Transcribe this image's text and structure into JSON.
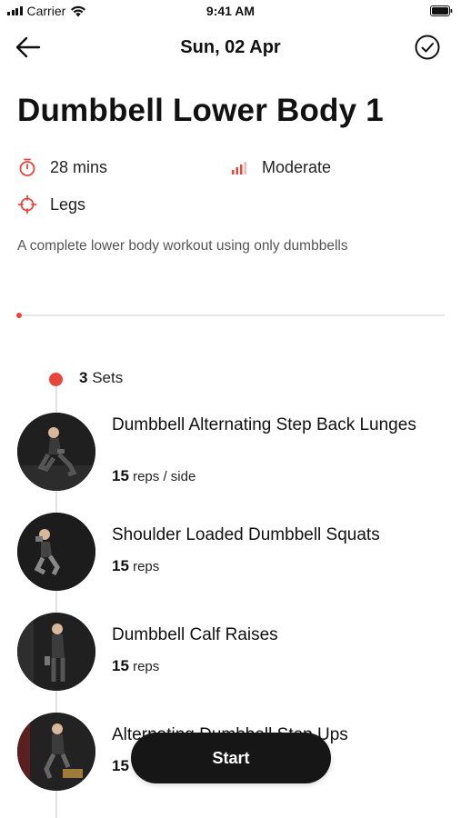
{
  "status_bar": {
    "carrier": "Carrier",
    "time": "9:41 AM"
  },
  "header": {
    "date": "Sun, 02 Apr",
    "back_icon": "arrow-left-icon",
    "done_icon": "check-circle-icon"
  },
  "workout": {
    "title": "Dumbbell Lower Body 1",
    "duration": "28 mins",
    "difficulty": "Moderate",
    "target": "Legs",
    "description": "A complete lower body workout using only dumbbells",
    "progress_fraction": 0.0
  },
  "sets": {
    "count": "3",
    "label": "Sets"
  },
  "exercises": [
    {
      "name": "Dumbbell Alternating Step Back Lunges",
      "reps": "15",
      "unit": "reps / side"
    },
    {
      "name": "Shoulder Loaded Dumbbell Squats",
      "reps": "15",
      "unit": "reps"
    },
    {
      "name": "Dumbbell Calf Raises",
      "reps": "15",
      "unit": "reps"
    },
    {
      "name": "Alternating Dumbbell Step Ups",
      "reps": "15",
      "unit": ""
    }
  ],
  "start_button": {
    "label": "Start"
  },
  "colors": {
    "accent": "#e8463c",
    "button_bg": "#161616",
    "text": "#111111",
    "muted": "#555555",
    "divider": "#e6e6e6"
  }
}
